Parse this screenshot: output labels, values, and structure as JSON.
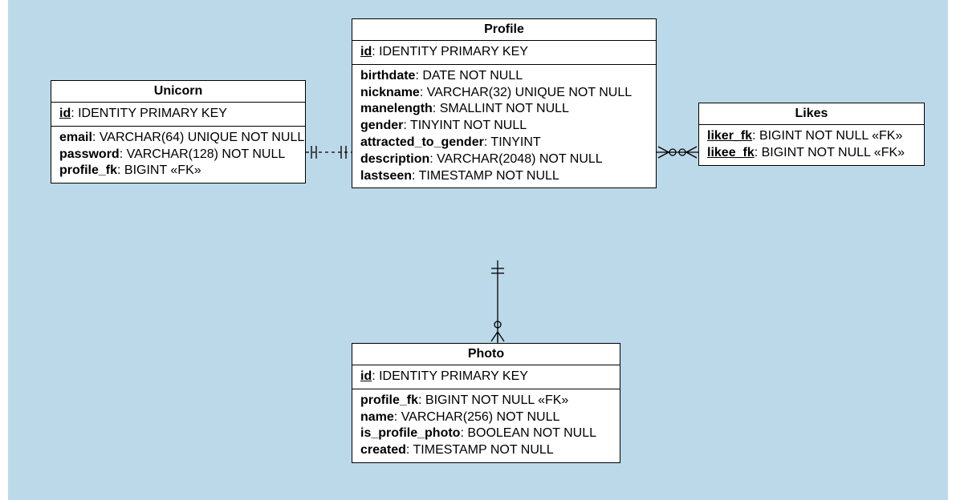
{
  "entities": {
    "unicorn": {
      "name": "Unicorn",
      "pk": {
        "field": "id",
        "type": ": IDENTITY PRIMARY KEY"
      },
      "attrs": [
        {
          "field": "email",
          "type": ": VARCHAR(64) UNIQUE NOT NULL"
        },
        {
          "field": "password",
          "type": ": VARCHAR(128) NOT NULL"
        },
        {
          "field": "profile_fk",
          "type": ": BIGINT «FK»"
        }
      ]
    },
    "profile": {
      "name": "Profile",
      "pk": {
        "field": "id",
        "type": ": IDENTITY PRIMARY KEY"
      },
      "attrs": [
        {
          "field": "birthdate",
          "type": ": DATE NOT NULL"
        },
        {
          "field": "nickname",
          "type": ": VARCHAR(32) UNIQUE NOT NULL"
        },
        {
          "field": "manelength",
          "type": ": SMALLINT NOT NULL"
        },
        {
          "field": "gender",
          "type": ": TINYINT NOT NULL"
        },
        {
          "field": "attracted_to_gender",
          "type": ": TINYINT"
        },
        {
          "field": "description",
          "type": ": VARCHAR(2048) NOT NULL"
        },
        {
          "field": "lastseen",
          "type": ": TIMESTAMP NOT NULL"
        }
      ]
    },
    "likes": {
      "name": "Likes",
      "attrs": [
        {
          "field": "liker_fk",
          "type": ": BIGINT NOT NULL «FK»",
          "pk": true
        },
        {
          "field": "likee_fk",
          "type": ": BIGINT NOT NULL «FK»",
          "pk": true
        }
      ]
    },
    "photo": {
      "name": "Photo",
      "pk": {
        "field": "id",
        "type": ": IDENTITY PRIMARY KEY"
      },
      "attrs": [
        {
          "field": "profile_fk",
          "type": ": BIGINT NOT NULL «FK»"
        },
        {
          "field": "name",
          "type": ": VARCHAR(256) NOT NULL"
        },
        {
          "field": "is_profile_photo",
          "type": ": BOOLEAN NOT NULL"
        },
        {
          "field": "created",
          "type": ": TIMESTAMP NOT NULL"
        }
      ]
    }
  }
}
